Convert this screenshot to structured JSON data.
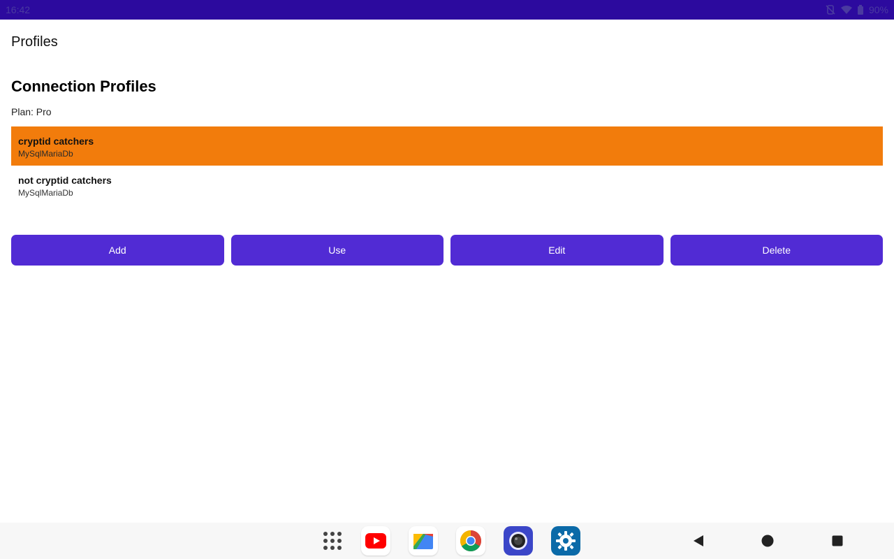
{
  "status_bar": {
    "time": "16:42",
    "battery": "90%"
  },
  "app": {
    "title": "Profiles"
  },
  "main": {
    "section_title": "Connection Profiles",
    "plan": "Plan: Pro",
    "profiles": [
      {
        "name": "cryptid catchers",
        "type": "MySqlMariaDb",
        "selected": true
      },
      {
        "name": "not cryptid catchers",
        "type": "MySqlMariaDb",
        "selected": false
      }
    ],
    "buttons": {
      "add": "Add",
      "use": "Use",
      "edit": "Edit",
      "delete": "Delete"
    }
  },
  "colors": {
    "status_bar": "#2c0a9e",
    "selected_row": "#f27c0c",
    "button": "#512bd4"
  },
  "dock": {
    "icons": [
      "app-drawer-icon",
      "youtube-icon",
      "files-icon",
      "chrome-icon",
      "camera-icon",
      "settings-icon"
    ]
  },
  "nav": {
    "icons": [
      "back-icon",
      "home-icon",
      "recents-icon"
    ]
  }
}
